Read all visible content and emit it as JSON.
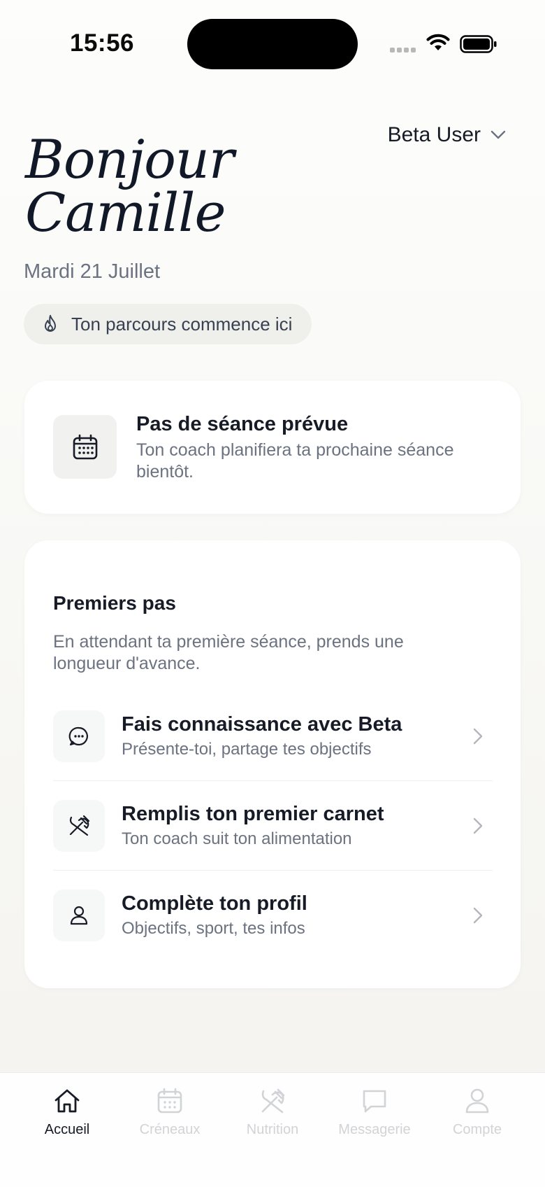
{
  "status_bar": {
    "time": "15:56"
  },
  "header": {
    "user_name": "Beta User"
  },
  "greeting": {
    "line1": "Bonjour",
    "line2": "Camille"
  },
  "date": "Mardi 21 Juillet",
  "journey_pill": {
    "label": "Ton parcours commence ici",
    "icon": "flame-icon"
  },
  "session_card": {
    "icon": "calendar-icon",
    "title": "Pas de séance prévue",
    "description": "Ton coach planifiera ta prochaine séance bientôt."
  },
  "first_steps": {
    "title": "Premiers pas",
    "description": "En attendant ta première séance, prends une longueur d'avance.",
    "items": [
      {
        "icon": "chat-bubble-icon",
        "title": "Fais connaissance avec Beta",
        "subtitle": "Présente-toi, partage tes objectifs"
      },
      {
        "icon": "utensils-icon",
        "title": "Remplis ton premier carnet",
        "subtitle": "Ton coach suit ton alimentation"
      },
      {
        "icon": "user-icon",
        "title": "Complète ton profil",
        "subtitle": "Objectifs, sport, tes infos"
      }
    ]
  },
  "tab_bar": {
    "active": "Accueil",
    "tabs": [
      {
        "label": "Accueil",
        "icon": "home-icon"
      },
      {
        "label": "Créneaux",
        "icon": "calendar-icon"
      },
      {
        "label": "Nutrition",
        "icon": "utensils-icon"
      },
      {
        "label": "Messagerie",
        "icon": "message-icon"
      },
      {
        "label": "Compte",
        "icon": "user-icon"
      }
    ]
  },
  "colors": {
    "text_primary": "#161b26",
    "text_secondary": "#6b7280",
    "tab_inactive": "#d1d3d6"
  }
}
